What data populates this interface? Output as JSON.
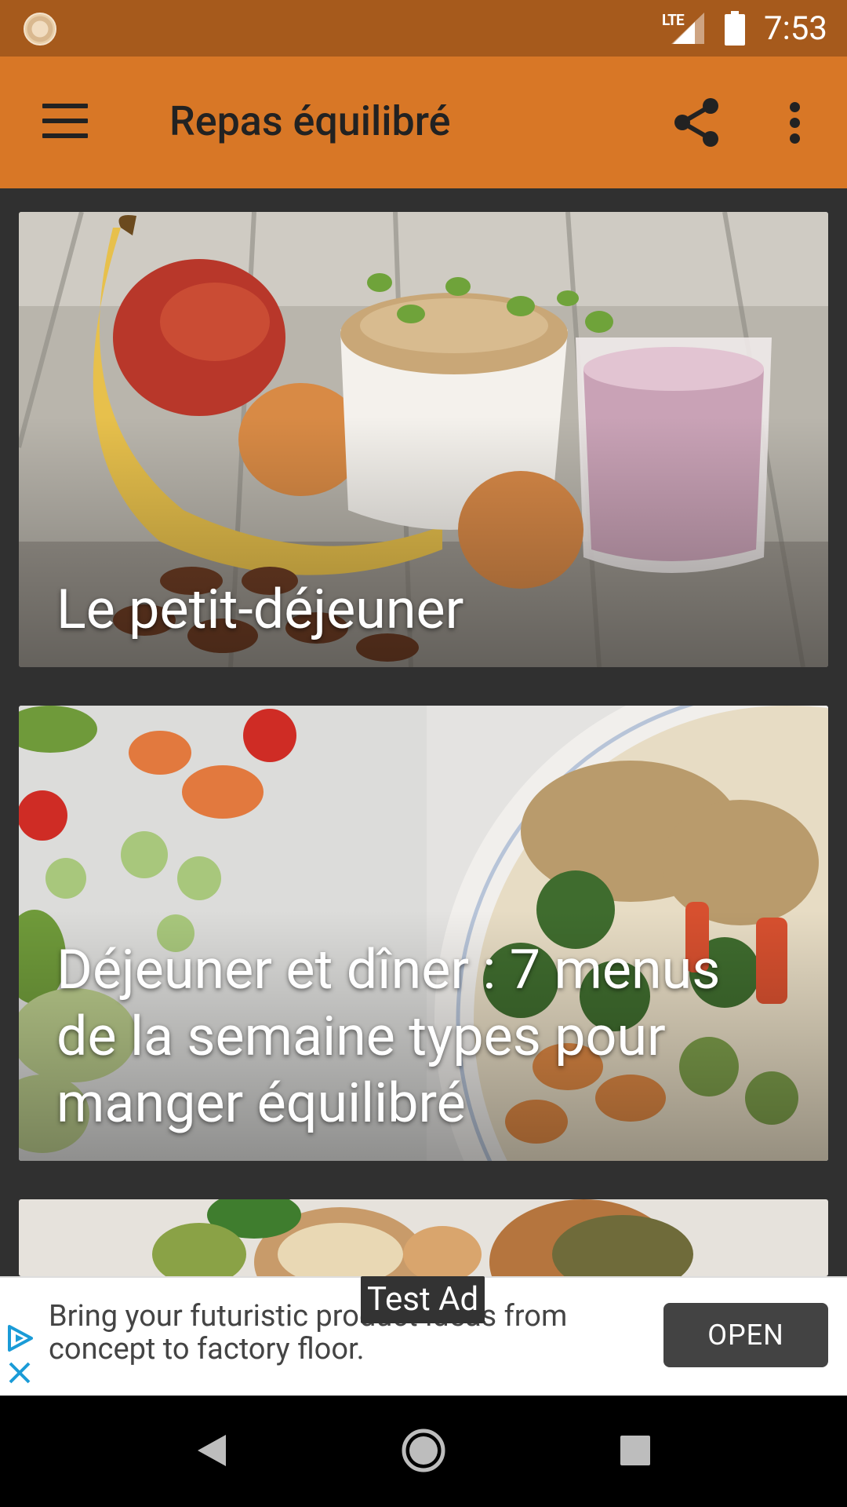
{
  "status_bar": {
    "network": "LTE",
    "time": "7:53"
  },
  "app_bar": {
    "title": "Repas équilibré"
  },
  "cards": [
    {
      "title": "Le petit-déjeuner"
    },
    {
      "title": "Déjeuner et dîner : 7 menus de la semaine types pour manger équilibré"
    },
    {
      "title": ""
    }
  ],
  "ad": {
    "label": "Test Ad",
    "text": "Bring your futuristic product ideas from concept to factory floor.",
    "cta": "OPEN"
  },
  "icons": [
    "menu-icon",
    "share-icon",
    "more-vert-icon",
    "ad-choices-icon",
    "close-icon",
    "back-icon",
    "home-icon",
    "recents-icon"
  ],
  "colors": {
    "status_bar": "#a65a1c",
    "app_bar": "#d87726",
    "background": "#303030"
  }
}
